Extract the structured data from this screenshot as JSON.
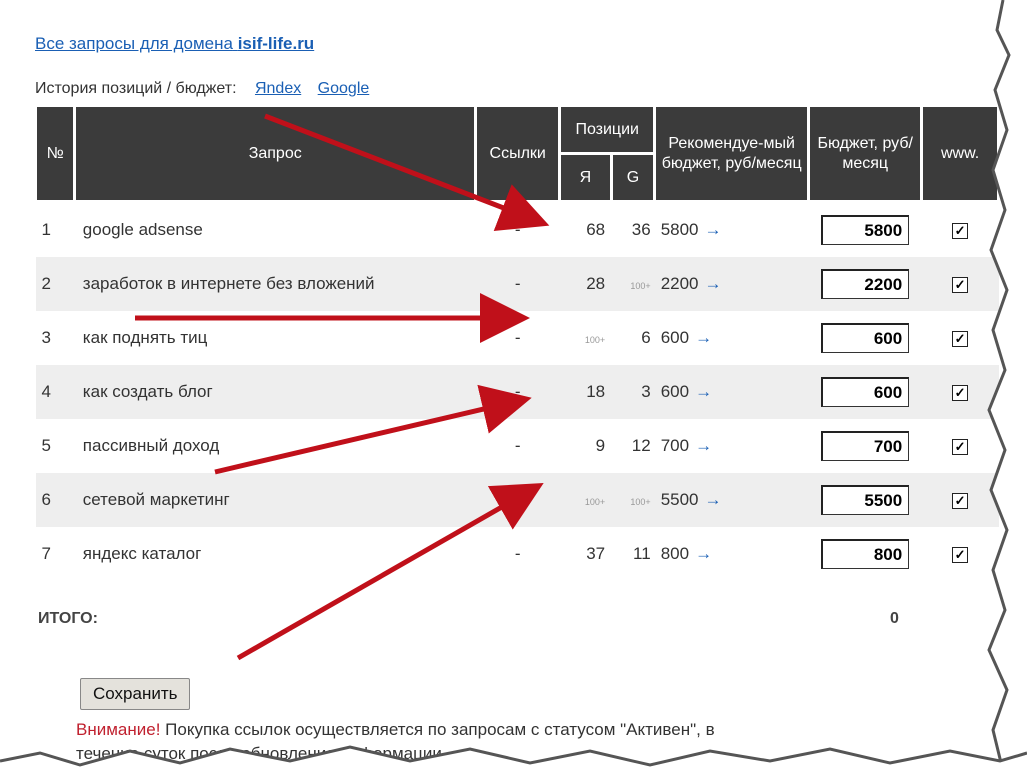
{
  "header": {
    "domain_link_prefix": "Все запросы для домена",
    "domain_name": "isif-life.ru",
    "history_label": "История позиций / бюджет:",
    "history_links": [
      "Яndex",
      "Google"
    ]
  },
  "table": {
    "headers": {
      "num": "№",
      "query": "Запрос",
      "links": "Ссылки",
      "positions": "Позиции",
      "pos_y": "Я",
      "pos_g": "G",
      "recommended": "Рекомендуе-мый бюджет, руб/месяц",
      "budget": "Бюджет, руб/месяц",
      "www": "www."
    },
    "rows": [
      {
        "num": "1",
        "query": "google adsense",
        "links": "-",
        "y": "68",
        "g": "36",
        "rec": "5800",
        "budget": "5800",
        "www": true
      },
      {
        "num": "2",
        "query": "заработок в интернете без вложений",
        "links": "-",
        "y": "28",
        "g": "100+",
        "rec": "2200",
        "budget": "2200",
        "www": true
      },
      {
        "num": "3",
        "query": "как поднять тиц",
        "links": "-",
        "y": "100+",
        "g": "6",
        "rec": "600",
        "budget": "600",
        "www": true
      },
      {
        "num": "4",
        "query": "как создать блог",
        "links": "-",
        "y": "18",
        "g": "3",
        "rec": "600",
        "budget": "600",
        "www": true
      },
      {
        "num": "5",
        "query": "пассивный доход",
        "links": "-",
        "y": "9",
        "g": "12",
        "rec": "700",
        "budget": "700",
        "www": true
      },
      {
        "num": "6",
        "query": "сетевой маркетинг",
        "links": "-",
        "y": "100+",
        "g": "100+",
        "rec": "5500",
        "budget": "5500",
        "www": true
      },
      {
        "num": "7",
        "query": "яндекс каталог",
        "links": "-",
        "y": "37",
        "g": "11",
        "rec": "800",
        "budget": "800",
        "www": true
      }
    ],
    "rec_arrow": "→"
  },
  "footer": {
    "total_label": "ИТОГО:",
    "total_value": "0",
    "save_label": "Сохранить",
    "warning_prefix": "Внимание!",
    "warning_text": " Покупка ссылок осуществляется по запросам с статусом \"Активен\", в",
    "warning_line2": "течение суток после обновления информации"
  },
  "colors": {
    "header_bg": "#3b3b3b",
    "link": "#1a5fb4",
    "annotation_arrow": "#c0101a",
    "warning": "#c0202e"
  }
}
